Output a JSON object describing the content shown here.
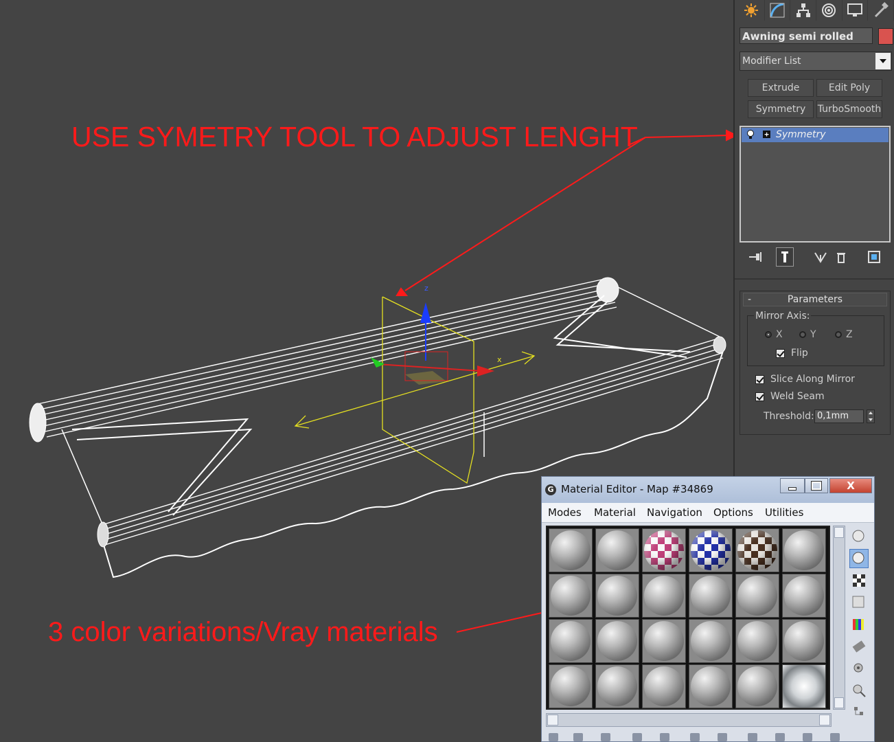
{
  "viewport": {
    "annotations": {
      "top": "USE SYMETRY TOOL TO ADJUST LENGHT",
      "bottom": "3 color variations/Vray materials"
    },
    "gizmo_axes": {
      "x": "x",
      "z": "z"
    },
    "annotation_color": "#ff1a1a"
  },
  "command_panel": {
    "tabs": [
      "create-icon",
      "modify-icon",
      "hierarchy-icon",
      "motion-icon",
      "display-icon",
      "utilities-icon"
    ],
    "object_name": "Awning semi rolled",
    "object_color": "#d9534f",
    "modifier_list_label": "Modifier List",
    "modifier_buttons": [
      "Extrude",
      "Edit Poly",
      "Symmetry",
      "TurboSmooth"
    ],
    "stack": [
      {
        "label": "Symmetry",
        "plus": "+"
      }
    ],
    "stack_tools": [
      "pin-stack-icon",
      "show-end-result-icon",
      "make-unique-icon",
      "remove-modifier-icon",
      "configure-sets-icon"
    ],
    "parameters": {
      "title": "Parameters",
      "collapse": "-",
      "mirror_axis_label": "Mirror Axis:",
      "axes": [
        {
          "label": "X",
          "selected": true
        },
        {
          "label": "Y",
          "selected": false
        },
        {
          "label": "Z",
          "selected": false
        }
      ],
      "flip_label": "Flip",
      "slice_label": "Slice Along Mirror",
      "weld_label": "Weld Seam",
      "threshold_label": "Threshold:",
      "threshold_value": "0,1mm"
    }
  },
  "material_editor": {
    "app_icon": "G",
    "title": "Material Editor - Map #34869",
    "close_glyph": "X",
    "menus": [
      "Modes",
      "Material",
      "Navigation",
      "Options",
      "Utilities"
    ],
    "slots": [
      "gray",
      "gray",
      "magenta",
      "blue",
      "brown",
      "gray",
      "gray",
      "gray",
      "gray",
      "gray",
      "gray",
      "gray",
      "gray",
      "gray",
      "gray",
      "gray",
      "gray",
      "gray",
      "gray",
      "gray",
      "gray",
      "gray",
      "gray",
      "env"
    ],
    "side_tools": [
      "sample-type-icon",
      "backlight-icon",
      "background-icon",
      "uv-tiling-icon",
      "video-color-check-icon",
      "make-preview-icon",
      "options-icon",
      "select-by-material-icon",
      "material-map-navigator-icon"
    ]
  }
}
